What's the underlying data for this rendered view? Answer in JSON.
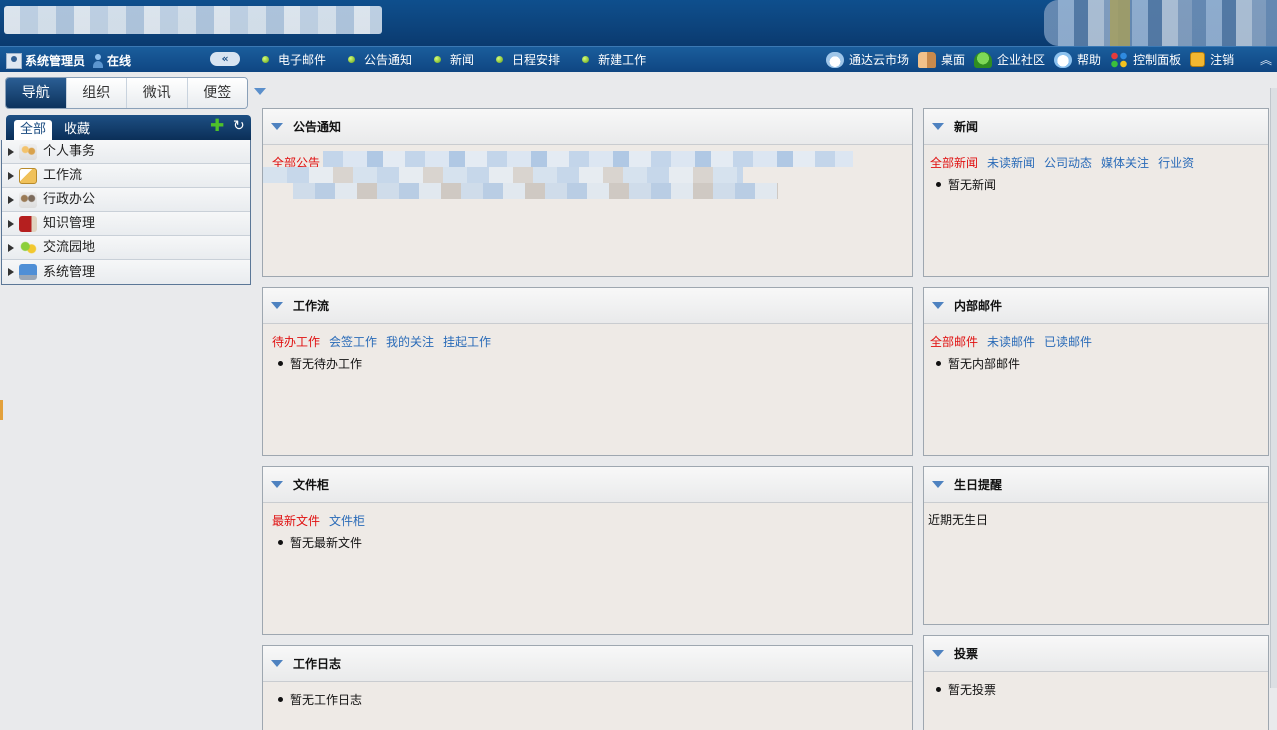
{
  "toolbar": {
    "user_name": "系统管理员",
    "user_status": "在线",
    "collapse_glyph": "«",
    "quick_links": [
      "电子邮件",
      "公告通知",
      "新闻",
      "日程安排",
      "新建工作"
    ],
    "right_links": [
      {
        "icon": "cloud-market-icon",
        "label": "通达云市场"
      },
      {
        "icon": "desktop-icon",
        "label": "桌面"
      },
      {
        "icon": "community-icon",
        "label": "企业社区"
      },
      {
        "icon": "help-icon",
        "label": "帮助"
      },
      {
        "icon": "control-panel-icon",
        "label": "控制面板"
      },
      {
        "icon": "logout-icon",
        "label": "注销"
      }
    ]
  },
  "left": {
    "tabs": [
      "导航",
      "组织",
      "微讯",
      "便签"
    ],
    "active_tab": "导航",
    "subtabs": [
      "全部",
      "收藏"
    ],
    "nav_items": [
      {
        "icon": "personal-affairs-icon",
        "label": "个人事务"
      },
      {
        "icon": "workflow-icon",
        "label": "工作流"
      },
      {
        "icon": "admin-office-icon",
        "label": "行政办公"
      },
      {
        "icon": "knowledge-icon",
        "label": "知识管理"
      },
      {
        "icon": "exchange-icon",
        "label": "交流园地"
      },
      {
        "icon": "system-admin-icon",
        "label": "系统管理"
      }
    ]
  },
  "portlets": {
    "notice": {
      "title": "公告通知",
      "link_first": "全部公告"
    },
    "news": {
      "title": "新闻",
      "links": [
        "全部新闻",
        "未读新闻",
        "公司动态",
        "媒体关注",
        "行业资"
      ],
      "empty": "暂无新闻"
    },
    "workflow": {
      "title": "工作流",
      "links": [
        "待办工作",
        "会签工作",
        "我的关注",
        "挂起工作"
      ],
      "empty": "暂无待办工作"
    },
    "mail": {
      "title": "内部邮件",
      "links": [
        "全部邮件",
        "未读邮件",
        "已读邮件"
      ],
      "empty": "暂无内部邮件"
    },
    "files": {
      "title": "文件柜",
      "links": [
        "最新文件",
        "文件柜"
      ],
      "empty": "暂无最新文件"
    },
    "birthday": {
      "title": "生日提醒",
      "text": "近期无生日"
    },
    "worklog": {
      "title": "工作日志",
      "empty": "暂无工作日志"
    },
    "vote": {
      "title": "投票",
      "empty": "暂无投票"
    }
  },
  "colors": {
    "accent_link": "#2a6bb8",
    "active_link": "#e01010",
    "header_blue": "#0d447d"
  }
}
